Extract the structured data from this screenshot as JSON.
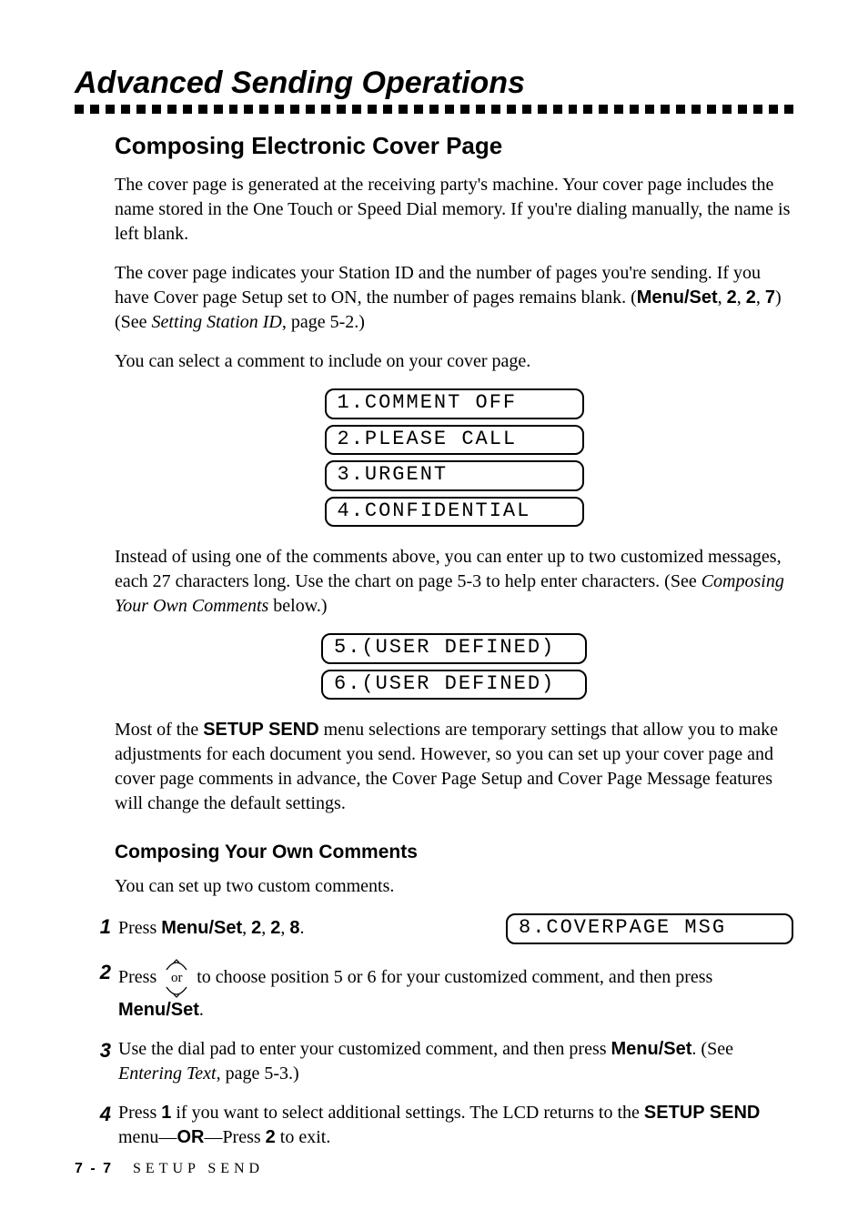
{
  "title": "Advanced Sending Operations",
  "h2": "Composing Electronic Cover Page",
  "p1": "The cover page is generated at the receiving party's machine. Your cover page includes the name stored in the One Touch or Speed Dial memory. If you're dialing manually, the name is left blank.",
  "p2_a": "The cover page indicates your Station ID and the number of pages you're sending. If you have Cover page Setup set to ON, the number of pages remains blank.  (",
  "p2_menu": "Menu/Set",
  "p2_b": ", ",
  "p2_2a": "2",
  "p2_c": ", ",
  "p2_2b": "2",
  "p2_d": ", ",
  "p2_7": "7",
  "p2_e": ") (See ",
  "p2_ref": "Setting Station ID",
  "p2_f": ", page 5-2.)",
  "p3": "You can select a comment to include on your cover page.",
  "lcd1": [
    "1.COMMENT OFF",
    "2.PLEASE CALL",
    "3.URGENT",
    "4.CONFIDENTIAL"
  ],
  "p4_a": "Instead of using one of the comments above, you can enter up to two customized messages, each 27 characters long. Use the chart on page 5-3 to help enter characters. (See ",
  "p4_ref": "Composing Your Own Comments",
  "p4_b": " below.)",
  "lcd2": [
    "5.(USER DEFINED)",
    "6.(USER DEFINED)"
  ],
  "p5_a": "Most of the ",
  "p5_setup": "SETUP SEND",
  "p5_b": " menu selections are temporary settings that allow you to make adjustments for each document you send. However, so you can set up your cover page and cover page comments in advance, the Cover Page Setup and Cover Page Message features will change the default settings.",
  "h3": "Composing Your Own Comments",
  "p6": "You can set up two custom comments.",
  "steps": {
    "n1": "1",
    "s1_a": "Press ",
    "s1_menu": "Menu/Set",
    "s1_b": ", ",
    "s1_2a": "2",
    "s1_c": ", ",
    "s1_2b": "2",
    "s1_d": ", ",
    "s1_8": "8",
    "s1_e": ".",
    "s1_lcd": "8.COVERPAGE MSG",
    "n2": "2",
    "s2_a": "Press ",
    "s2_b": "  to choose position 5 or 6 for your customized comment, and then press ",
    "s2_menu": "Menu/Set",
    "s2_c": ".",
    "n3": "3",
    "s3_a": "Use the dial pad to enter your customized comment, and then press ",
    "s3_menu": "Menu/Set",
    "s3_b": ". (See ",
    "s3_ref": "Entering Text",
    "s3_c": ", page 5-3.)",
    "n4": "4",
    "s4_a": "Press ",
    "s4_1": "1",
    "s4_b": " if you want to select additional settings. The LCD returns to the ",
    "s4_setup": "SETUP SEND",
    "s4_c": " menu—",
    "s4_or": "OR",
    "s4_d": "—Press ",
    "s4_2": "2",
    "s4_e": " to exit."
  },
  "footer": {
    "page": "7 - 7",
    "section": "SETUP SEND"
  },
  "icon_or_text": "or"
}
